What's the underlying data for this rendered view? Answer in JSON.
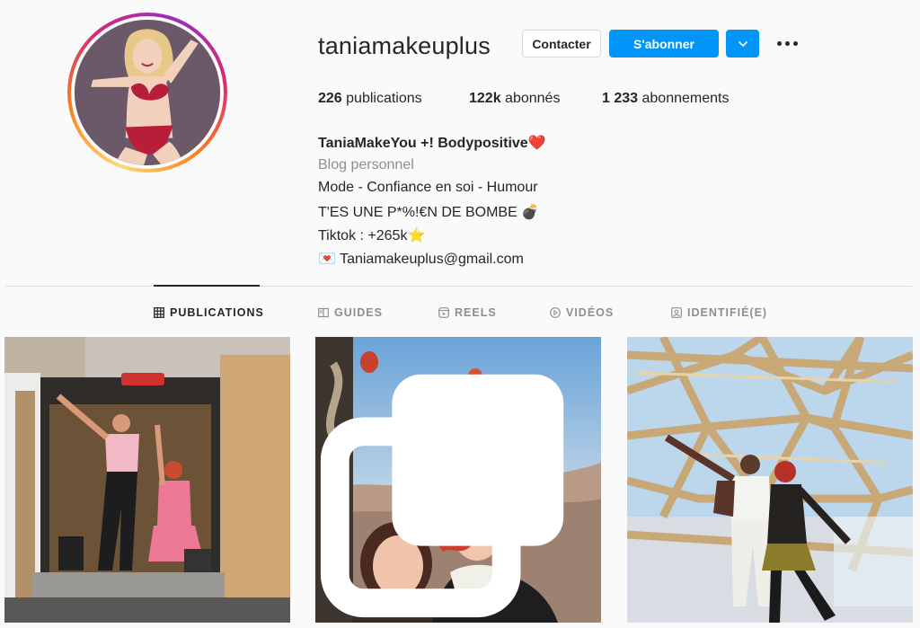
{
  "profile": {
    "username": "taniamakeuplus",
    "avatar_alt": "Illustration avatar"
  },
  "actions": {
    "contact_label": "Contacter",
    "follow_label": "S'abonner",
    "dropdown_icon": "chevron-down-icon",
    "more_icon": "more-options-icon"
  },
  "stats": {
    "posts_count": "226",
    "posts_label": "publications",
    "followers_count": "122k",
    "followers_label": "abonnés",
    "following_count": "1 233",
    "following_label": "abonnements"
  },
  "bio": {
    "name": "TaniaMakeYou +! Bodypositive",
    "name_emoji": "❤️",
    "category": "Blog personnel",
    "line1": "Mode - Confiance en soi - Humour",
    "line2": "T'ES UNE P*%!€N DE BOMBE",
    "line2_emoji": "💣",
    "line3": "Tiktok : +265k",
    "line3_emoji": "⭐",
    "email_emoji": "💌",
    "email": "Taniamakeuplus@gmail.com"
  },
  "tabs": [
    {
      "label": "PUBLICATIONS",
      "icon": "grid-icon",
      "active": true
    },
    {
      "label": "GUIDES",
      "icon": "guide-icon",
      "active": false
    },
    {
      "label": "REELS",
      "icon": "reels-icon",
      "active": false
    },
    {
      "label": "VIDÉOS",
      "icon": "video-play-icon",
      "active": false
    },
    {
      "label": "IDENTIFIÉ(E)",
      "icon": "tagged-icon",
      "active": false
    }
  ],
  "colors": {
    "accent_blue": "#0095f6",
    "text": "#262626",
    "muted": "#8e8e8e",
    "border": "#dbdbdb",
    "background": "#fafafa"
  }
}
